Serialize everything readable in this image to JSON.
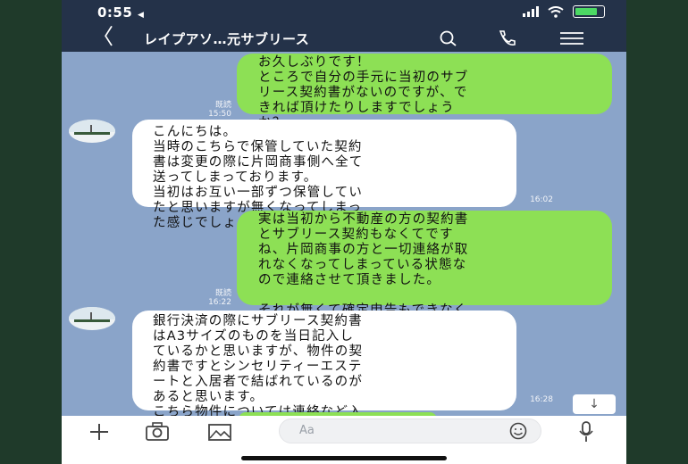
{
  "status": {
    "time": "0:55",
    "time_suffix": "◀"
  },
  "header": {
    "back": "〈",
    "title": "レイプアソ…元サブリース"
  },
  "messages": [
    {
      "text": "お久しぶりです！\nところで自分の手元に当初のサブ\nリース契約書がないのですが、で\nきれば頂けたりしますでしょう\nか？",
      "read": "既読",
      "time": "15:50"
    },
    {
      "text": "こんにちは。\n当時のこちらで保管していた契約\n書は変更の際に片岡商事側へ全て\n送ってしまっております。\n当初はお互い一部ずつ保管してい\nたと思いますが無くなってしまっ\nた感じでしょうか？",
      "time": "16:02"
    },
    {
      "text": "実は当初から不動産の方の契約書\nとサブリース契約もなくてです\nね、片岡商事の方と一切連絡が取\nれなくなってしまっている状態な\nので連絡させて頂きました。\n\nそれが無くて確定申告もできなく\nて困ってまして、、",
      "read": "既読",
      "time": "16:22"
    },
    {
      "text": "銀行決済の際にサブリース契約書\nはA3サイズのものを当日記入し\nているかと思いますが、物件の契\n約書ですとシンセリティーエステ\nートと入居者で結ばれているのが\nあると思います。\nこちら物件については連絡など入\nっていますでしょうか？",
      "time": "16:28"
    }
  ],
  "input": {
    "placeholder": "Aa"
  },
  "icons": {
    "search": "search-icon",
    "call": "phone-icon",
    "menu": "menu-icon",
    "plus": "plus-icon",
    "camera": "camera-icon",
    "image": "image-icon",
    "emoji": "emoji-icon",
    "mic": "microphone-icon",
    "scroll": "arrow-down-icon"
  },
  "colors": {
    "sent_bubble": "#8de055",
    "received_bubble": "#ffffff",
    "chat_bg": "#8aa4c9",
    "header_bg": "#243249"
  }
}
